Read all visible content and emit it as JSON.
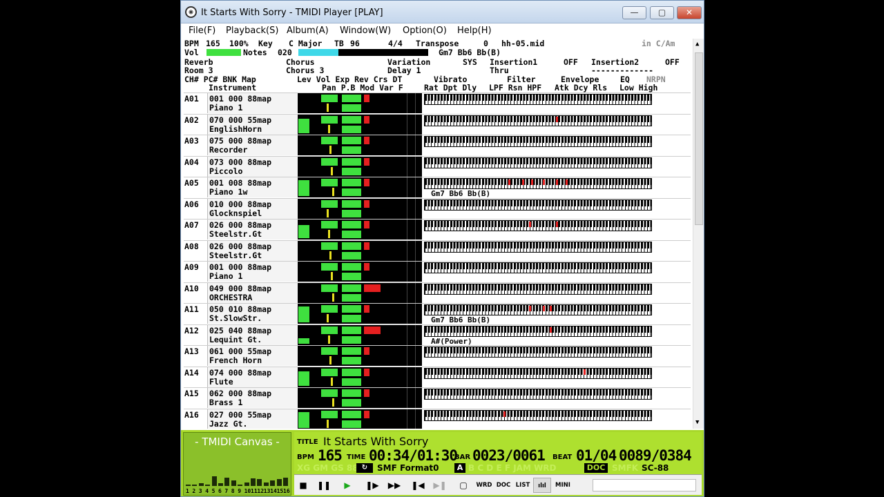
{
  "window": {
    "title": "It Starts With Sorry - TMIDI Player [PLAY]",
    "minimize": "—",
    "maximize": "▢",
    "close": "✕"
  },
  "menu": [
    "File(F)",
    "Playback(S)",
    "Album(A)",
    "Window(W)",
    "Option(O)",
    "Help(H)"
  ],
  "header": {
    "bpm_label": "BPM",
    "bpm_value": "165",
    "percent": "100%",
    "key_label": "Key",
    "key_value": "C Major",
    "tb_label": "TB",
    "tb_value": "96",
    "time_sig": "4/4",
    "transpose_label": "Transpose",
    "transpose_value": "0",
    "filename": "hh-05.mid",
    "key_mode": "in C/Am",
    "vol_label": "Vol",
    "notes_label": "Notes",
    "notes_value": "020",
    "chord": "Gm7 Bb6 Bb(B)",
    "reverb_label": "Reverb",
    "chorus_label": "Chorus",
    "variation_label": "Variation",
    "sys_label": "SYS",
    "insertion1_label": "Insertion1",
    "insertion1_value": "OFF",
    "insertion2_label": "Insertion2",
    "insertion2_value": "OFF",
    "reverb_value": "Room 3",
    "chorus_value": "Chorus 3",
    "delay_value": "Delay 1",
    "thru_value": "Thru",
    "dash_value": "-------------",
    "col1": "CH# PC# BNK Map",
    "col1b": "Instrument",
    "col2": "Lev Vol Exp Rev Crs DT",
    "col2b": "Pan P.B Mod Var F",
    "vibrato": "Vibrato",
    "vibrato_sub": "Rat Dpt Dly",
    "filter": "Filter",
    "filter_sub": "LPF Rsn HPF",
    "envelope": "Envelope",
    "envelope_sub": "Atk Dcy Rls",
    "eq": "EQ",
    "eq_sub": "Low High",
    "nrpn": "NRPN"
  },
  "channels": [
    {
      "ch": "A01",
      "prog": "001 000 88map",
      "name": "Piano 1",
      "lev": 0,
      "chord": "",
      "notes": []
    },
    {
      "ch": "A02",
      "prog": "070 000 55map",
      "name": "EnglishHorn",
      "lev": 0.85,
      "chord": "",
      "notes": [
        0.58
      ]
    },
    {
      "ch": "A03",
      "prog": "075 000 88map",
      "name": "Recorder",
      "lev": 0,
      "chord": "",
      "notes": []
    },
    {
      "ch": "A04",
      "prog": "073 000 88map",
      "name": "Piccolo",
      "lev": 0,
      "chord": "",
      "notes": []
    },
    {
      "ch": "A05",
      "prog": "001 008 88map",
      "name": "Piano 1w",
      "lev": 0.9,
      "chord": "Gm7 Bb6 Bb(B)",
      "notes": [
        0.37,
        0.43,
        0.47,
        0.52,
        0.58,
        0.62
      ]
    },
    {
      "ch": "A06",
      "prog": "010 000 88map",
      "name": "Glocknspiel",
      "lev": 0,
      "chord": "",
      "notes": []
    },
    {
      "ch": "A07",
      "prog": "026 000 88map",
      "name": "Steelstr.Gt",
      "lev": 0.75,
      "chord": "",
      "notes": [
        0.46,
        0.58
      ]
    },
    {
      "ch": "A08",
      "prog": "026 000 88map",
      "name": "Steelstr.Gt",
      "lev": 0,
      "chord": "",
      "notes": []
    },
    {
      "ch": "A09",
      "prog": "001 000 88map",
      "name": "Piano 1",
      "lev": 0,
      "chord": "",
      "notes": []
    },
    {
      "ch": "A10",
      "prog": "049 000 88map",
      "name": "ORCHESTRA",
      "lev": 0,
      "chord": "",
      "notes": []
    },
    {
      "ch": "A11",
      "prog": "050 010 88map",
      "name": "St.SlowStr.",
      "lev": 0.9,
      "chord": "Gm7 Bb6 Bb(B)",
      "notes": [
        0.46,
        0.52,
        0.55
      ]
    },
    {
      "ch": "A12",
      "prog": "025 040 88map",
      "name": "Lequint Gt.",
      "lev": 0.3,
      "chord": "A#(Power)",
      "notes": [
        0.55
      ]
    },
    {
      "ch": "A13",
      "prog": "061 000 55map",
      "name": "French Horn",
      "lev": 0,
      "chord": "",
      "notes": []
    },
    {
      "ch": "A14",
      "prog": "074 000 88map",
      "name": "Flute",
      "lev": 0.85,
      "chord": "",
      "notes": [
        0.7
      ]
    },
    {
      "ch": "A15",
      "prog": "062 000 88map",
      "name": "Brass 1",
      "lev": 0,
      "chord": "",
      "notes": []
    },
    {
      "ch": "A16",
      "prog": "027 000 55map",
      "name": "Jazz Gt.",
      "lev": 0.9,
      "chord": "",
      "notes": [
        0.35
      ]
    }
  ],
  "canvas": {
    "title": "- TMIDI Canvas -",
    "numbers": [
      "1",
      "2",
      "3",
      "4",
      "5",
      "6",
      "7",
      "8",
      "9",
      "10",
      "11",
      "12",
      "13",
      "14",
      "15",
      "16"
    ]
  },
  "lcd": {
    "title_label": "TITLE",
    "title": "It Starts With Sorry",
    "bpm_label": "BPM",
    "bpm": "165",
    "time_label": "TIME",
    "time": "00:34/01:30",
    "bar_label": "BAR",
    "bar": "0023/0061",
    "beat_label": "BEAT",
    "beat": "01/04",
    "tick": "0089/0384",
    "format": "SMF Format0",
    "port": "A",
    "doc": "DOC",
    "module": "SC-88"
  },
  "transport": {
    "stop": "■",
    "pause": "❚❚",
    "play": "▶",
    "step": "❚▶",
    "ffwd": "▶▶",
    "prev": "❚◀",
    "next": "▶❚",
    "window": "▢",
    "wrd": "WRD",
    "docb": "DOC",
    "list": "LIST",
    "meter": "ılıl",
    "mini": "MINI"
  }
}
